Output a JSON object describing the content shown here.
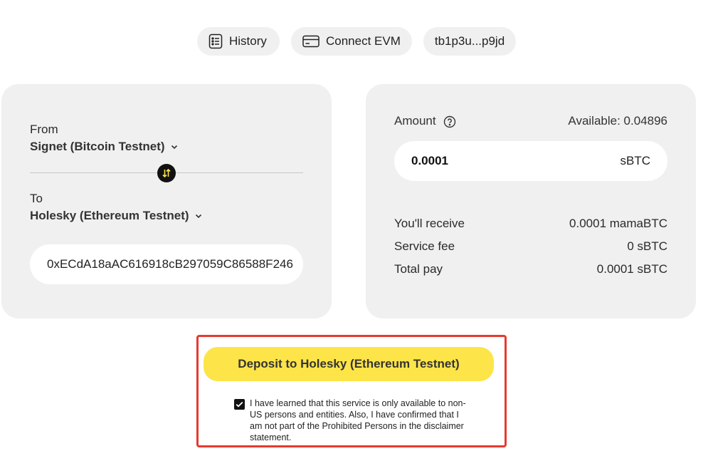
{
  "header": {
    "history_label": "History",
    "connect_evm_label": "Connect EVM",
    "wallet_address": "tb1p3u...p9jd"
  },
  "bridge": {
    "from_label": "From",
    "from_network": "Signet (Bitcoin Testnet)",
    "to_label": "To",
    "to_network": "Holesky (Ethereum Testnet)",
    "destination_address": "0xECdA18aAC616918cB297059C86588F246"
  },
  "amount": {
    "label": "Amount",
    "available": "Available: 0.04896",
    "value": "0.0001",
    "unit": "sBTC"
  },
  "summary": {
    "receive_label": "You'll receive",
    "receive_value": "0.0001 mamaBTC",
    "fee_label": "Service fee",
    "fee_value": "0 sBTC",
    "total_label": "Total pay",
    "total_value": "0.0001 sBTC"
  },
  "action": {
    "deposit_label": "Deposit to Holesky (Ethereum Testnet)",
    "checkbox_checked": true,
    "disclaimer": "I have learned that this service is only available to non-US persons and entities. Also, I have confirmed that I am not part of the Prohibited Persons in the disclaimer statement."
  },
  "colors": {
    "accent_yellow": "#fde448",
    "highlight_red": "#e63a2e",
    "card_bg": "#f0f0f0"
  },
  "icons": {
    "history": "list-icon",
    "connect_evm": "card-icon",
    "swap": "swap-arrows-icon",
    "help": "question-circle-icon",
    "dropdown": "chevron-down-icon"
  }
}
